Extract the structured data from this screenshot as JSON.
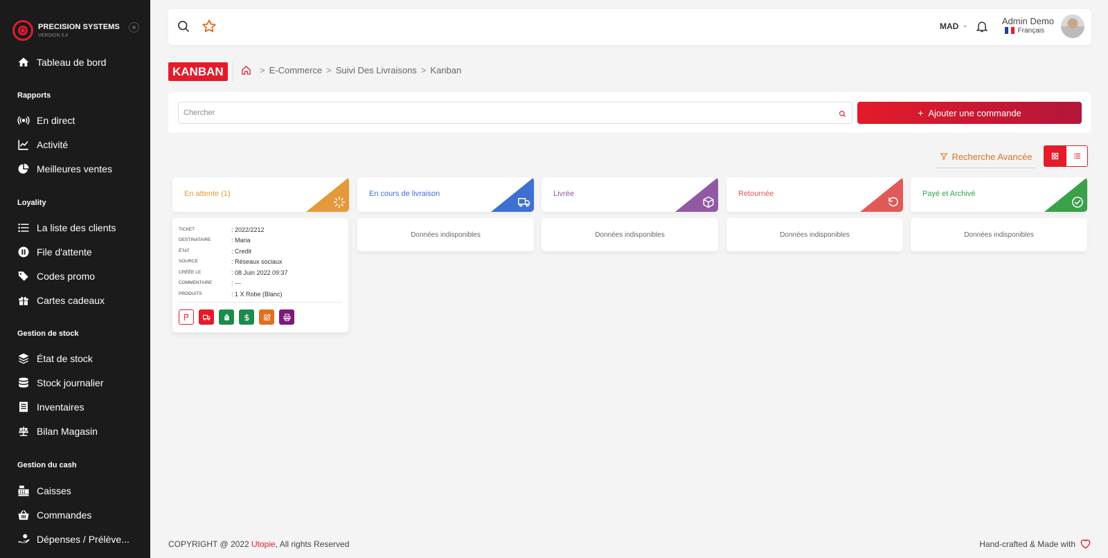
{
  "brand": {
    "name": "PRECISION SYSTEMS",
    "version": "VERSION 5.4"
  },
  "sidebar": {
    "dashboard": "Tableau de bord",
    "sections": [
      "Rapports",
      "Loyality",
      "Gestion de stock",
      "Gestion du cash"
    ],
    "items": [
      {
        "label": "En direct",
        "icon": "broadcast-icon"
      },
      {
        "label": "Activité",
        "icon": "chart-line-icon"
      },
      {
        "label": "Meilleures ventes",
        "icon": "pie-chart-icon"
      },
      {
        "label": "La liste des clients",
        "icon": "list-icon"
      },
      {
        "label": "File d'attente",
        "icon": "pause-icon"
      },
      {
        "label": "Codes promo",
        "icon": "tags-icon"
      },
      {
        "label": "Cartes cadeaux",
        "icon": "gift-icon"
      },
      {
        "label": "État de stock",
        "icon": "layers-icon"
      },
      {
        "label": "Stock journalier",
        "icon": "database-icon"
      },
      {
        "label": "Inventaires",
        "icon": "receipt-icon"
      },
      {
        "label": "Bilan Magasin",
        "icon": "scale-icon"
      },
      {
        "label": "Caisses",
        "icon": "cash-register-icon"
      },
      {
        "label": "Commandes",
        "icon": "basket-icon"
      },
      {
        "label": "Dépenses / Prélève...",
        "icon": "hand-coin-icon"
      }
    ]
  },
  "topbar": {
    "currency": "MAD",
    "user_name": "Admin Demo",
    "language": "Français"
  },
  "breadcrumb": {
    "page_tag": "KANBAN",
    "items": [
      "E-Commerce",
      "Suivi Des Livraisons",
      "Kanban"
    ]
  },
  "search": {
    "placeholder": "Chercher",
    "add_button": "Ajouter une commande"
  },
  "filters": {
    "advanced": "Recherche Avancée"
  },
  "columns": [
    {
      "title": "En attente (1)",
      "color": "#e39a3c",
      "icon": "spinner-icon"
    },
    {
      "title": "En cours de livraison",
      "color": "#3f6fd1",
      "icon": "truck-icon"
    },
    {
      "title": "Livrée",
      "color": "#8f5aa3",
      "icon": "box-icon"
    },
    {
      "title": "Retournée",
      "color": "#e05a5a",
      "icon": "undo-icon"
    },
    {
      "title": "Payé et Archivé",
      "color": "#3aa04a",
      "icon": "check-circle-icon"
    }
  ],
  "empty_text": "Données indisponibles",
  "order_card": {
    "fields": [
      {
        "label": "Ticket",
        "value": ": 2022/2212"
      },
      {
        "label": "Destinataire",
        "value": ": Maria"
      },
      {
        "label": "État",
        "value": ": Credit"
      },
      {
        "label": "Source",
        "value": ": Réseaux sociaux"
      },
      {
        "label": "Créée le",
        "value": ": 08 Juin 2022 09:37"
      },
      {
        "label": "Commentaire",
        "value": ": ---"
      },
      {
        "label": "Produits",
        "value": ": 1 X Robe (Blanc)"
      }
    ]
  },
  "footer": {
    "copyright_prefix": "COPYRIGHT @ 2022 ",
    "company": "Utopie",
    "copyright_suffix": ", All rights Reserved",
    "made_with": "Hand-crafted & Made with"
  }
}
